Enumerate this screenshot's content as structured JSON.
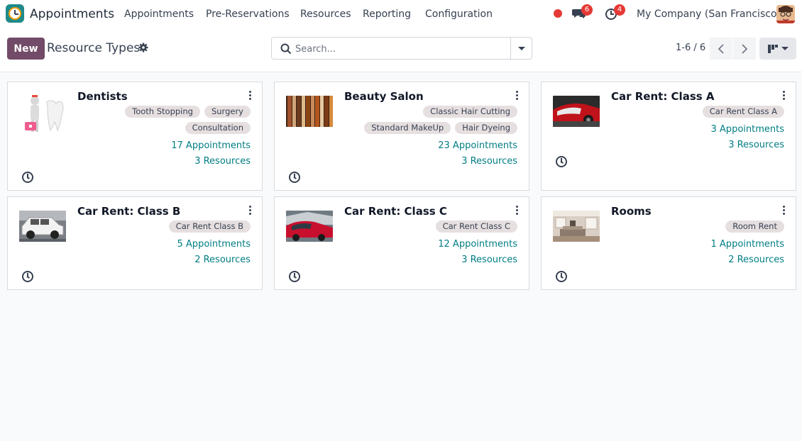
{
  "navbar": {
    "app_name": "Appointments",
    "menu": [
      "Appointments",
      "Pre-Reservations",
      "Resources",
      "Reporting",
      "Configuration"
    ],
    "messages_count": "6",
    "activities_count": "4",
    "company": "My Company (San Francisco)"
  },
  "control": {
    "new_label": "New",
    "title": "Resource Types",
    "search_placeholder": "Search...",
    "pager": "1-6 / 6"
  },
  "cards": [
    {
      "title": "Dentists",
      "tags": [
        "Tooth Stopping",
        "Surgery",
        "Consultation"
      ],
      "appointments": "17 Appointments",
      "resources": "3 Resources"
    },
    {
      "title": "Beauty Salon",
      "tags": [
        "Classic Hair Cutting",
        "Standard MakeUp",
        "Hair Dyeing"
      ],
      "appointments": "23 Appointments",
      "resources": "3 Resources"
    },
    {
      "title": "Car Rent: Class A",
      "tags": [
        "Car Rent Class A"
      ],
      "appointments": "3 Appointments",
      "resources": "3 Resources"
    },
    {
      "title": "Car Rent: Class B",
      "tags": [
        "Car Rent Class B"
      ],
      "appointments": "5 Appointments",
      "resources": "2 Resources"
    },
    {
      "title": "Car Rent: Class C",
      "tags": [
        "Car Rent Class C"
      ],
      "appointments": "12 Appointments",
      "resources": "3 Resources"
    },
    {
      "title": "Rooms",
      "tags": [
        "Room Rent"
      ],
      "appointments": "1 Appointments",
      "resources": "2 Resources"
    }
  ],
  "colors": {
    "brand": "#714b67",
    "link": "#017e84",
    "tag_bg": "#e6dfe0",
    "badge": "#e53935"
  }
}
